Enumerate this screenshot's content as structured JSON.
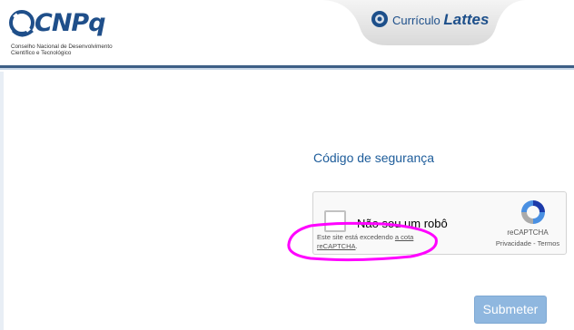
{
  "header": {
    "logo_text": "CNPq",
    "logo_subtitle_line1": "Conselho Nacional de Desenvolvimento",
    "logo_subtitle_line2": "Científico e Tecnológico",
    "curriculo_label": "Currículo",
    "lattes_label": "Lattes"
  },
  "main": {
    "section_title": "Código de segurança",
    "captcha": {
      "checkbox_label": "Não sou um robô",
      "quota_text": "Este site está excedendo ",
      "quota_link": "a cota",
      "quota_link2": "reCAPTCHA",
      "quota_end": ".",
      "brand": "reCAPTCHA",
      "privacy": "Privacidade",
      "separator": " - ",
      "terms": "Termos"
    },
    "submit_label": "Submeter"
  },
  "colors": {
    "brand_blue": "#1f4f8a",
    "title_blue": "#1d5c9a",
    "submit_bg": "#8fb7df",
    "highlight": "#ff00ff"
  },
  "icons": [
    "cnpq-logo-icon",
    "lattes-icon",
    "recaptcha-logo-icon"
  ]
}
